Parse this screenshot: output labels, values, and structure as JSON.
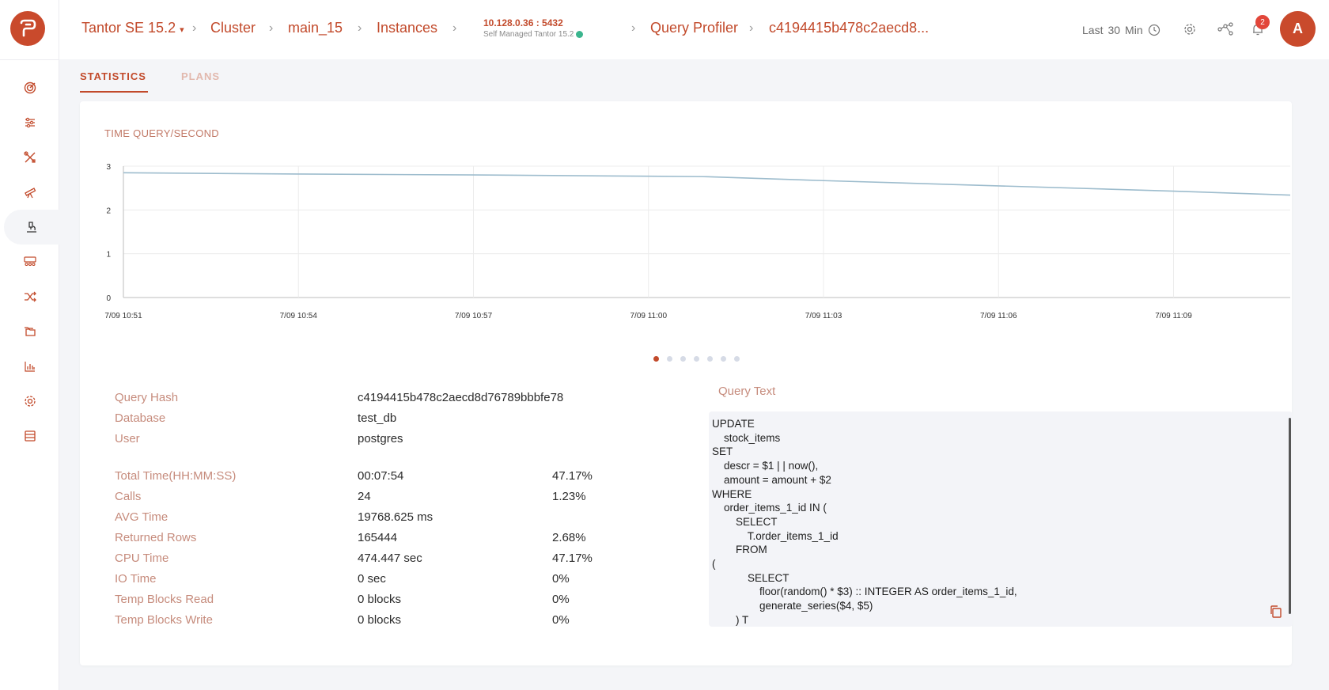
{
  "breadcrumbs": {
    "product": "Tantor SE 15.2",
    "cluster": "Cluster",
    "db": "main_15",
    "instances": "Instances",
    "instance_addr": "10.128.0.36 : 5432",
    "instance_sub": "Self Managed Tantor 15.2",
    "query_profiler": "Query Profiler",
    "query_hash_short": "c4194415b478c2aecd8..."
  },
  "time_range": {
    "prefix": "Last",
    "value": "30",
    "unit": "Min"
  },
  "notifications": {
    "count": "2"
  },
  "user": {
    "initial": "A"
  },
  "tabs": [
    {
      "label": "STATISTICS",
      "active": true
    },
    {
      "label": "PLANS",
      "active": false
    }
  ],
  "chart_title": "TIME QUERY/SECOND",
  "chart_data": {
    "type": "line",
    "title": "TIME QUERY/SECOND",
    "xlabel": "",
    "ylabel": "",
    "ylim": [
      0,
      3
    ],
    "grid": true,
    "x_ticks": [
      "7/09 10:51",
      "7/09 10:54",
      "7/09 10:57",
      "7/09 11:00",
      "7/09 11:03",
      "7/09 11:06",
      "7/09 11:09"
    ],
    "y_ticks": [
      "0",
      "1",
      "2",
      "3"
    ],
    "x_range_minutes": [
      0,
      20
    ],
    "series": [
      {
        "color": "#9dbccd",
        "x": [
          0,
          3,
          6,
          9,
          10,
          12,
          15,
          18,
          20
        ],
        "y": [
          2.85,
          2.82,
          2.8,
          2.77,
          2.76,
          2.67,
          2.55,
          2.43,
          2.34
        ]
      }
    ]
  },
  "pagination": {
    "count": 7,
    "active": 0
  },
  "stats": [
    {
      "label": "Query Hash",
      "value": "c4194415b478c2aecd8d76789bbbfe78",
      "pct": ""
    },
    {
      "label": "Database",
      "value": "test_db",
      "pct": ""
    },
    {
      "label": "User",
      "value": "postgres",
      "pct": ""
    },
    {
      "label": "Total Time(HH:MM:SS)",
      "value": "00:07:54",
      "pct": "47.17%"
    },
    {
      "label": "Calls",
      "value": "24",
      "pct": "1.23%"
    },
    {
      "label": "AVG Time",
      "value": "19768.625 ms",
      "pct": ""
    },
    {
      "label": "Returned Rows",
      "value": "165444",
      "pct": "2.68%"
    },
    {
      "label": "CPU Time",
      "value": "474.447 sec",
      "pct": "47.17%"
    },
    {
      "label": "IO Time",
      "value": "0 sec",
      "pct": "0%"
    },
    {
      "label": "Temp Blocks Read",
      "value": "0 blocks",
      "pct": "0%"
    },
    {
      "label": "Temp Blocks Write",
      "value": "0 blocks",
      "pct": "0%"
    }
  ],
  "query_text_label": "Query Text",
  "query_text": "UPDATE\n    stock_items\nSET\n    descr = $1 | | now(),\n    amount = amount + $2\nWHERE\n    order_items_1_id IN (\n        SELECT\n            T.order_items_1_id\n        FROM\n(\n            SELECT\n                floor(random() * $3) :: INTEGER AS order_items_1_id,\n                generate_series($4, $5)\n        ) T",
  "icons": {
    "nav": [
      "dashboard-icon",
      "sliders-icon",
      "tools-icon",
      "telescope-icon",
      "microscope-icon",
      "users-icon",
      "shuffle-icon",
      "folders-icon",
      "bar-chart-icon",
      "gear-icon",
      "database-icon"
    ],
    "active_nav_index": 4
  }
}
